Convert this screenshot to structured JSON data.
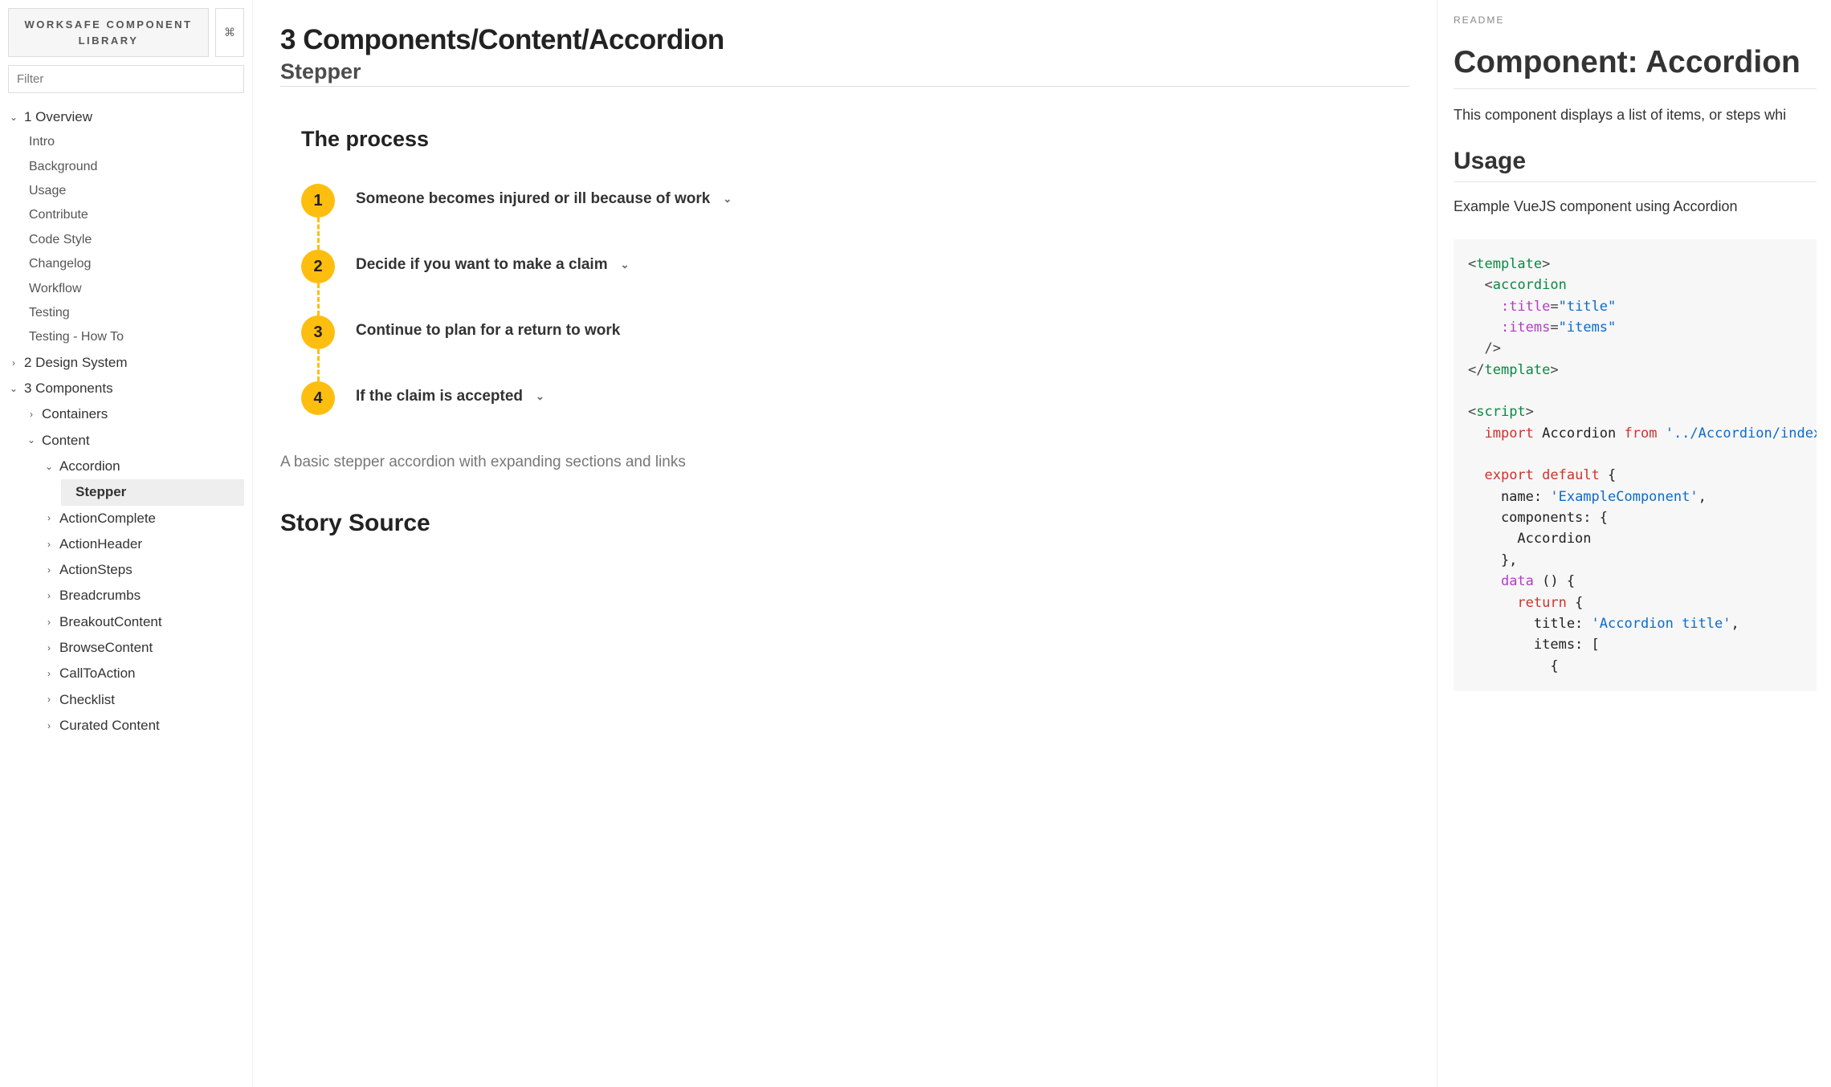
{
  "sidebar": {
    "brand": "WORKSAFE COMPONENT LIBRARY",
    "shortcut_glyph": "⌘",
    "filter_placeholder": "Filter",
    "tree": {
      "s1": {
        "label": "1 Overview",
        "expanded": true,
        "items": [
          "Intro",
          "Background",
          "Usage",
          "Contribute",
          "Code Style",
          "Changelog",
          "Workflow",
          "Testing",
          "Testing - How To"
        ]
      },
      "s2": {
        "label": "2 Design System",
        "expanded": false
      },
      "s3": {
        "label": "3 Components",
        "expanded": true,
        "containers": {
          "label": "Containers",
          "expanded": false
        },
        "content": {
          "label": "Content",
          "expanded": true,
          "accordion": {
            "label": "Accordion",
            "expanded": true,
            "stepper": {
              "label": "Stepper",
              "selected": true
            }
          },
          "rest": [
            "ActionComplete",
            "ActionHeader",
            "ActionSteps",
            "Breadcrumbs",
            "BreakoutContent",
            "BrowseContent",
            "CallToAction",
            "Checklist",
            "Curated Content"
          ]
        }
      }
    }
  },
  "main": {
    "breadcrumb_title": "3 Components/Content/Accordion",
    "subtitle": "Stepper",
    "process_title": "The process",
    "steps": [
      {
        "n": "1",
        "text": "Someone becomes injured or ill because of work",
        "expandable": true
      },
      {
        "n": "2",
        "text": "Decide if you want to make a claim",
        "expandable": true
      },
      {
        "n": "3",
        "text": "Continue to plan for a return to work",
        "expandable": false
      },
      {
        "n": "4",
        "text": "If the claim is accepted",
        "expandable": true
      }
    ],
    "caption": "A basic stepper accordion with expanding sections and links",
    "story_source_heading": "Story Source"
  },
  "readme": {
    "label": "README",
    "h1": "Component: Accordion",
    "intro": "This component displays a list of items, or steps whi",
    "h2": "Usage",
    "usage_intro": "Example VueJS component using Accordion",
    "code_tokens": [
      [
        "punc",
        "<"
      ],
      [
        "tag",
        "template"
      ],
      [
        "punc",
        ">"
      ],
      [
        "nl",
        ""
      ],
      [
        "txt",
        "  "
      ],
      [
        "punc",
        "<"
      ],
      [
        "tag",
        "accordion"
      ],
      [
        "nl",
        ""
      ],
      [
        "txt",
        "    "
      ],
      [
        "attr",
        ":title"
      ],
      [
        "punc",
        "="
      ],
      [
        "str",
        "\"title\""
      ],
      [
        "nl",
        ""
      ],
      [
        "txt",
        "    "
      ],
      [
        "attr",
        ":items"
      ],
      [
        "punc",
        "="
      ],
      [
        "str",
        "\"items\""
      ],
      [
        "nl",
        ""
      ],
      [
        "txt",
        "  "
      ],
      [
        "punc",
        "/>"
      ],
      [
        "nl",
        ""
      ],
      [
        "punc",
        "</"
      ],
      [
        "tag",
        "template"
      ],
      [
        "punc",
        ">"
      ],
      [
        "nl",
        ""
      ],
      [
        "nl",
        ""
      ],
      [
        "punc",
        "<"
      ],
      [
        "tag",
        "script"
      ],
      [
        "punc",
        ">"
      ],
      [
        "nl",
        ""
      ],
      [
        "txt",
        "  "
      ],
      [
        "kw",
        "import"
      ],
      [
        "txt",
        " Accordion "
      ],
      [
        "kw",
        "from"
      ],
      [
        "txt",
        " "
      ],
      [
        "str",
        "'../Accordion/index."
      ],
      [
        "nl",
        ""
      ],
      [
        "nl",
        ""
      ],
      [
        "txt",
        "  "
      ],
      [
        "kw",
        "export"
      ],
      [
        "txt",
        " "
      ],
      [
        "kw",
        "default"
      ],
      [
        "txt",
        " {"
      ],
      [
        "nl",
        ""
      ],
      [
        "txt",
        "    name: "
      ],
      [
        "str",
        "'ExampleComponent'"
      ],
      [
        "txt",
        ","
      ],
      [
        "nl",
        ""
      ],
      [
        "txt",
        "    components: {"
      ],
      [
        "nl",
        ""
      ],
      [
        "txt",
        "      Accordion"
      ],
      [
        "nl",
        ""
      ],
      [
        "txt",
        "    },"
      ],
      [
        "nl",
        ""
      ],
      [
        "txt",
        "    "
      ],
      [
        "attr",
        "data"
      ],
      [
        "txt",
        " () {"
      ],
      [
        "nl",
        ""
      ],
      [
        "txt",
        "      "
      ],
      [
        "kw",
        "return"
      ],
      [
        "txt",
        " {"
      ],
      [
        "nl",
        ""
      ],
      [
        "txt",
        "        title: "
      ],
      [
        "str",
        "'Accordion title'"
      ],
      [
        "txt",
        ","
      ],
      [
        "nl",
        ""
      ],
      [
        "txt",
        "        items: ["
      ],
      [
        "nl",
        ""
      ],
      [
        "txt",
        "          {"
      ],
      [
        "nl",
        ""
      ]
    ]
  }
}
